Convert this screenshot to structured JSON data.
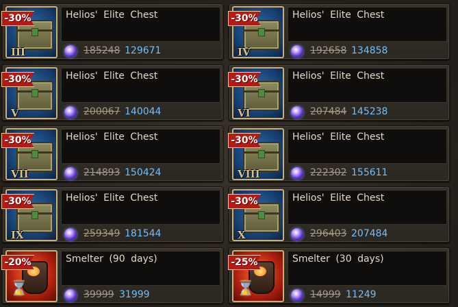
{
  "items": [
    {
      "discount": "-30%",
      "title": "Helios' Elite Chest",
      "roman": "III",
      "old_price": "185248",
      "new_price": "129671",
      "type": "chest"
    },
    {
      "discount": "-30%",
      "title": "Helios' Elite Chest",
      "roman": "IV",
      "old_price": "192658",
      "new_price": "134858",
      "type": "chest"
    },
    {
      "discount": "-30%",
      "title": "Helios' Elite Chest",
      "roman": "V",
      "old_price": "200067",
      "new_price": "140044",
      "type": "chest"
    },
    {
      "discount": "-30%",
      "title": "Helios' Elite Chest",
      "roman": "VI",
      "old_price": "207484",
      "new_price": "145238",
      "type": "chest"
    },
    {
      "discount": "-30%",
      "title": "Helios' Elite Chest",
      "roman": "VII",
      "old_price": "214893",
      "new_price": "150424",
      "type": "chest"
    },
    {
      "discount": "-30%",
      "title": "Helios' Elite Chest",
      "roman": "VIII",
      "old_price": "222302",
      "new_price": "155611",
      "type": "chest"
    },
    {
      "discount": "-30%",
      "title": "Helios' Elite Chest",
      "roman": "IX",
      "old_price": "259349",
      "new_price": "181544",
      "type": "chest"
    },
    {
      "discount": "-30%",
      "title": "Helios' Elite Chest",
      "roman": "X",
      "old_price": "296403",
      "new_price": "207484",
      "type": "chest"
    },
    {
      "discount": "-20%",
      "title": "Smelter (90 days)",
      "roman": "",
      "old_price": "39999",
      "new_price": "31999",
      "type": "smelter"
    },
    {
      "discount": "-25%",
      "title": "Smelter (30 days)",
      "roman": "",
      "old_price": "14999",
      "new_price": "11249",
      "type": "smelter"
    }
  ],
  "icons": {
    "currency": "purple-gem-icon",
    "chest": "chest-icon",
    "smelter": "smelter-icon",
    "hourglass": "hourglass-icon",
    "hourglass_glyph": "⌛"
  },
  "colors": {
    "discount_badge": "#b31b14",
    "new_price": "#6ec0ff",
    "old_price": "#a79a88",
    "title_text": "#e4d9c6"
  }
}
